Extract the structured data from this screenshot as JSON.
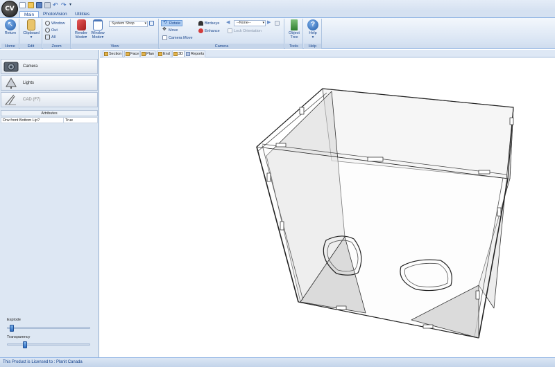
{
  "app": {
    "logo_text": "CV"
  },
  "tabs": [
    "Main",
    "PhotoVision",
    "Utilities"
  ],
  "ribbon": {
    "home": {
      "button": "Return",
      "group": "Home"
    },
    "edit": {
      "button": "Clipboard",
      "group": "Edit"
    },
    "zoom": {
      "window": "Window",
      "out": "Out",
      "all": "All",
      "group": "Zoom"
    },
    "view": {
      "render": "Render Mode",
      "window_mode": "Window Mode",
      "shop_value": "System Shop",
      "group": "View"
    },
    "camera": {
      "rotate": "Rotate",
      "move": "Move",
      "camera_move": "Camera Move",
      "birdseye": "Birdseye",
      "enhance": "Enhance",
      "none_value": "--None--",
      "lock": "Lock Orientation",
      "group": "Camera"
    },
    "tools": {
      "object_tree": "Object Tree",
      "group": "Tools"
    },
    "help": {
      "button": "Help",
      "group": "Help"
    }
  },
  "view_tabs": [
    "Section",
    "Face",
    "Plan",
    "End",
    "3D",
    "Reports"
  ],
  "left_panel": {
    "nav": [
      "Camera",
      "Lights",
      "CAD (F7)"
    ],
    "attributes_title": "Attributes",
    "attributes": [
      {
        "key": "Drw front Bottom Lip?",
        "value": "True"
      }
    ],
    "explode_label": "Explode",
    "transparency_label": "Transparency",
    "explode_value": 0.03,
    "transparency_value": 0.2
  },
  "status": "This Product is Licensed to : Planit Canada",
  "colors": {
    "ribbon_accent": "#8db2e3",
    "panel_bg": "#dde7f3"
  }
}
